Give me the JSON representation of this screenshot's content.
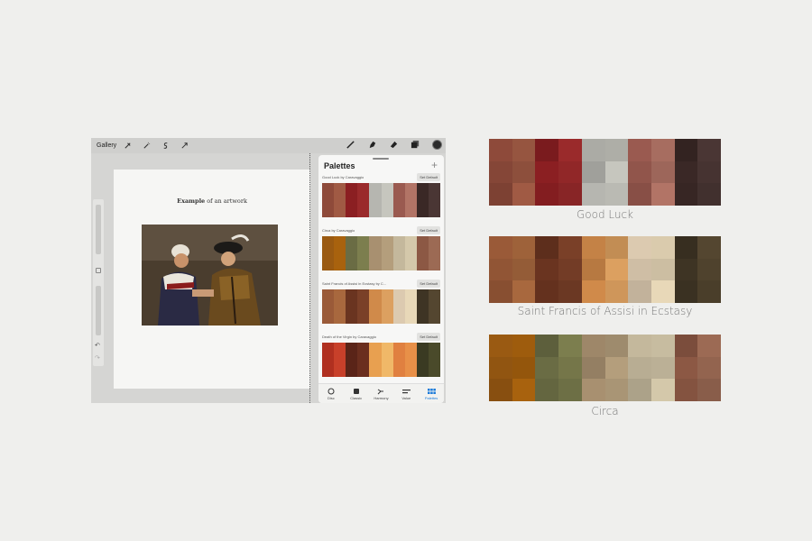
{
  "app": {
    "gallery_label": "Gallery",
    "toolbar_left": [
      "wrench-icon",
      "magic-wand-icon",
      "selection-icon",
      "transform-icon"
    ],
    "toolbar_right": [
      "brush-icon",
      "smudge-icon",
      "eraser-icon",
      "layers-icon",
      "color-icon"
    ]
  },
  "canvas": {
    "caption_bold": "Example",
    "caption_rest": " of an artwork"
  },
  "panel": {
    "title": "Palettes",
    "add_icon": "+",
    "palettes": [
      {
        "name": "Good Luck by Caravaggio",
        "button": "Set Default",
        "colors": [
          "#8e4a3a",
          "#a05a44",
          "#8b1f22",
          "#9a2a2b",
          "#b6b6b0",
          "#c6c6be",
          "#9a5a50",
          "#b27466",
          "#3a2826",
          "#4a3634"
        ]
      },
      {
        "name": "Circa by Caravaggio",
        "button": "Set Default",
        "colors": [
          "#9a5a12",
          "#a8620e",
          "#6a6c44",
          "#7c7e4e",
          "#a89070",
          "#b49e7c",
          "#c4b89c",
          "#d4c8aa",
          "#8c5844",
          "#9c6a54"
        ]
      },
      {
        "name": "Saint Francis of Assisi in Ecstasy by C...",
        "button": "Set Default",
        "colors": [
          "#9a5a38",
          "#a8683e",
          "#6a3420",
          "#7a4028",
          "#d08a4a",
          "#dca060",
          "#dccab0",
          "#e8d8b8",
          "#3e3424",
          "#544630"
        ]
      },
      {
        "name": "Death of the Virgin by Caravaggio",
        "button": "Set Default",
        "colors": [
          "#b03020",
          "#c8402a",
          "#5a2418",
          "#6a2e1e",
          "#e8a050",
          "#f0b868",
          "#e08040",
          "#e89048",
          "#3a3a22",
          "#4a4a2a"
        ]
      }
    ],
    "tabs": [
      {
        "label": "Disc",
        "icon": "disc-icon"
      },
      {
        "label": "Classic",
        "icon": "classic-icon"
      },
      {
        "label": "Harmony",
        "icon": "harmony-icon"
      },
      {
        "label": "Value",
        "icon": "value-icon"
      },
      {
        "label": "Palettes",
        "icon": "palettes-icon",
        "active": true
      }
    ]
  },
  "swatches": [
    {
      "label": "Good Luck",
      "rows": [
        [
          "#9c4c3a",
          "#a2583f",
          "#9c5440",
          "#a05c42",
          "#8a1f22",
          "#972a2a",
          "#9c2528",
          "#a32d2d",
          "#b0b0a8",
          "#b8b8b0",
          "#c0c0b8",
          "#c8c8c0",
          "#9a5848",
          "#a06050",
          "#b07060",
          "#b87a6a",
          "#3a2828",
          "#443030",
          "#3c2a2a",
          "#4a3636"
        ]
      ]
    },
    {
      "label": "Saint Francis of Assisi in Ecstasy"
    },
    {
      "label": "Circa"
    }
  ]
}
